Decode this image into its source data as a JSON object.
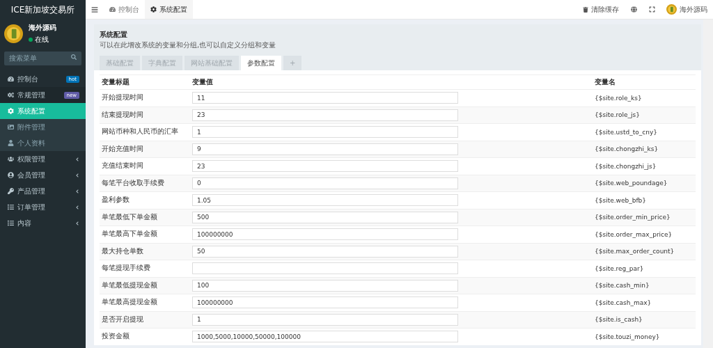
{
  "sidebar": {
    "brand": "ICE新加坡交易所",
    "user": {
      "name": "海外源码",
      "status": "在线"
    },
    "search": {
      "placeholder": "搜索菜单"
    },
    "menu": [
      {
        "label": "控制台",
        "selected": false,
        "badge": {
          "text": "hot",
          "color": "#0073b7"
        }
      },
      {
        "label": "常规管理",
        "selected": false,
        "expanded": true,
        "badge": {
          "text": "new",
          "color": "#605ca8"
        },
        "children": [
          {
            "label": "系统配置",
            "selected": true
          },
          {
            "label": "附件管理",
            "selected": false
          },
          {
            "label": "个人资料",
            "selected": false
          }
        ]
      },
      {
        "label": "权限管理",
        "selected": false,
        "expanded": false
      },
      {
        "label": "会员管理",
        "selected": false,
        "expanded": false
      },
      {
        "label": "产品管理",
        "selected": false,
        "expanded": false
      },
      {
        "label": "订单管理",
        "selected": false,
        "expanded": false
      },
      {
        "label": "内容",
        "selected": false,
        "expanded": false
      }
    ]
  },
  "topbar": {
    "tabs": [
      {
        "label": "控制台",
        "selected": false
      },
      {
        "label": "系统配置",
        "selected": true
      }
    ],
    "clear_cache": "清除缓存",
    "user_name": "海外源码"
  },
  "panel": {
    "title": "系统配置",
    "description": "可以在此增改系统的变量和分组,也可以自定义分组和变量",
    "tabs": [
      {
        "label": "基础配置",
        "selected": false
      },
      {
        "label": "字典配置",
        "selected": false
      },
      {
        "label": "网站基础配置",
        "selected": false
      },
      {
        "label": "参数配置",
        "selected": true
      }
    ],
    "add_tab": "+",
    "columns": [
      "变量标题",
      "变量值",
      "变量名"
    ],
    "rows": [
      {
        "title": "开始提现时间",
        "value": "11",
        "name": "{$site.role_ks}"
      },
      {
        "title": "结束提现时间",
        "value": "23",
        "name": "{$site.role_js}"
      },
      {
        "title": "网站币种和人民币的汇率",
        "value": "1",
        "name": "{$site.ustd_to_cny}"
      },
      {
        "title": "开始充值时间",
        "value": "9",
        "name": "{$site.chongzhi_ks}"
      },
      {
        "title": "充值结束时间",
        "value": "23",
        "name": "{$site.chongzhi_js}"
      },
      {
        "title": "每笔平台收取手续费",
        "value": "0",
        "name": "{$site.web_poundage}"
      },
      {
        "title": "盈利参数",
        "value": "1.05",
        "name": "{$site.web_bfb}"
      },
      {
        "title": "单笔最低下单金额",
        "value": "500",
        "name": "{$site.order_min_price}"
      },
      {
        "title": "单笔最高下单金额",
        "value": "100000000",
        "name": "{$site.order_max_price}"
      },
      {
        "title": "最大持仓单数",
        "value": "50",
        "name": "{$site.max_order_count}"
      },
      {
        "title": "每笔提现手续费",
        "name": "{$site.reg_par}"
      },
      {
        "title": "单笔最低提现金额",
        "value": "100",
        "name": "{$site.cash_min}"
      },
      {
        "title": "单笔最高提现金额",
        "value": "100000000",
        "name": "{$site.cash_max}"
      },
      {
        "title": "是否开启提现",
        "value": "1",
        "name": "{$site.is_cash}"
      },
      {
        "title": "投资金额",
        "value": "1000,5000,10000,50000,100000",
        "name": "{$site.touzi_money}"
      }
    ]
  }
}
